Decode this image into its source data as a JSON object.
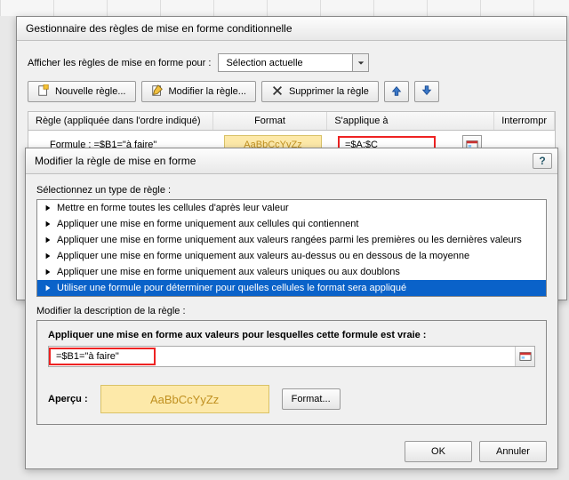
{
  "mgr": {
    "title": "Gestionnaire des règles de mise en forme conditionnelle",
    "show_rules_label": "Afficher les règles de mise en forme pour :",
    "scope_value": "Sélection actuelle",
    "new_rule": "Nouvelle règle...",
    "edit_rule": "Modifier la règle...",
    "delete_rule": "Supprimer la règle",
    "col_rule": "Règle (appliquée dans l'ordre indiqué)",
    "col_format": "Format",
    "col_applies": "S'applique à",
    "col_stop": "Interrompr",
    "rule_formula_label": "Formule : =$B1=\"à faire\"",
    "format_sample": "AaBbCcYyZz",
    "applies_value": "=$A:$C"
  },
  "edit": {
    "title": "Modifier la règle de mise en forme",
    "help": "?",
    "select_type_label": "Sélectionnez un type de règle :",
    "types": [
      "Mettre en forme toutes les cellules d'après leur valeur",
      "Appliquer une mise en forme uniquement aux cellules qui contiennent",
      "Appliquer une mise en forme uniquement aux valeurs rangées parmi les premières ou les dernières valeurs",
      "Appliquer une mise en forme uniquement aux valeurs au-dessus ou en dessous de la moyenne",
      "Appliquer une mise en forme uniquement aux valeurs uniques ou aux doublons",
      "Utiliser une formule pour déterminer pour quelles cellules le format sera appliqué"
    ],
    "desc_label": "Modifier la description de la règle :",
    "formula_heading": "Appliquer une mise en forme aux valeurs pour lesquelles cette formule est vraie :",
    "formula_value": "=$B1=\"à faire\"",
    "preview_label": "Aperçu :",
    "preview_sample": "AaBbCcYyZz",
    "format_btn": "Format...",
    "ok": "OK",
    "cancel": "Annuler"
  }
}
